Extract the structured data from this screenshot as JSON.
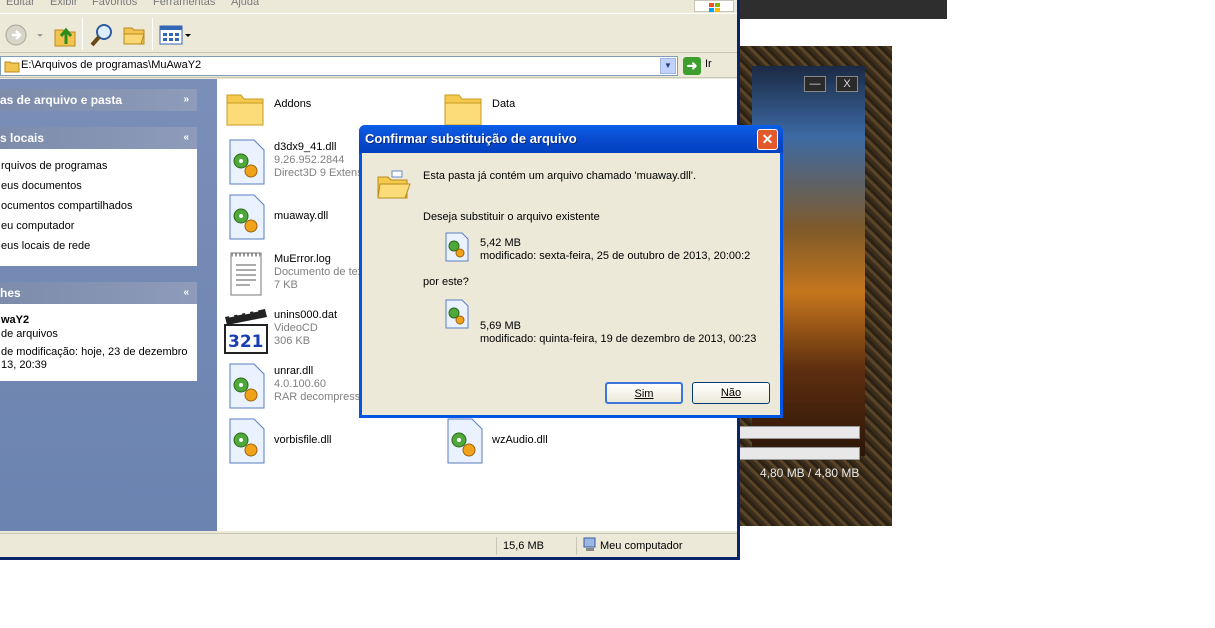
{
  "menu": {
    "items": [
      "Editar",
      "Exibir",
      "Favoritos",
      "Ferramentas",
      "Ajuda"
    ]
  },
  "address": {
    "path": "E:\\Arquivos de programas\\MuAwaY2",
    "go_label": "Ir"
  },
  "taskpane": {
    "sections": [
      {
        "title": "as de arquivo e pasta",
        "chevron": "»"
      },
      {
        "title": "s locais",
        "chevron": "«",
        "links": [
          "rquivos de programas",
          "eus documentos",
          "ocumentos compartilhados",
          "eu computador",
          "eus locais de rede"
        ]
      },
      {
        "title": "hes",
        "chevron": "«",
        "details": {
          "name": "waY2",
          "type": "de arquivos",
          "modified_line1": "de modificação: hoje, 23 de dezembro",
          "modified_line2": "13, 20:39"
        }
      }
    ]
  },
  "files": [
    {
      "name": "Addons",
      "lines": []
    },
    {
      "name": "Data",
      "lines": []
    },
    {
      "name": "d3dx9_41.dll",
      "lines": [
        "9.26.952.2844",
        "Direct3D 9 Extens"
      ]
    },
    {
      "name": "muaway.dll",
      "lines": []
    },
    {
      "name": "MuError.log",
      "lines": [
        "Documento de tex",
        "7 KB"
      ]
    },
    {
      "name": "unins000.dat",
      "lines": [
        "VideoCD",
        "306 KB"
      ]
    },
    {
      "name": "unrar.dll",
      "lines": [
        "4.0.100.60",
        "RAR decompressi"
      ]
    },
    {
      "name": "vorbisfile.dll",
      "lines": []
    },
    {
      "name": "wzAudio.dll",
      "lines": []
    }
  ],
  "statusbar": {
    "size": "15,6 MB",
    "location": "Meu computador"
  },
  "dialog": {
    "title": "Confirmar substituição de arquivo",
    "message": "Esta pasta já contém um arquivo chamado 'muaway.dll'.",
    "question": "Deseja substituir o arquivo existente",
    "existing": {
      "size": "5,42 MB",
      "modified": "modificado: sexta-feira, 25 de outubro de 2013, 20:00:2"
    },
    "by_this": "por este?",
    "new": {
      "size": "5,69 MB",
      "modified": "modificado: quinta-feira, 19 de dezembro de 2013, 00:23"
    },
    "yes_label": "Sim",
    "no_label": "Não"
  },
  "launcher": {
    "progress_text": "4,80 MB / 4,80 MB",
    "minimize_label": "—",
    "close_label": "X"
  },
  "colors": {
    "titlebar": "#0a4bd0",
    "taskpane": "#6b83b0",
    "close": "#e25a2c"
  }
}
